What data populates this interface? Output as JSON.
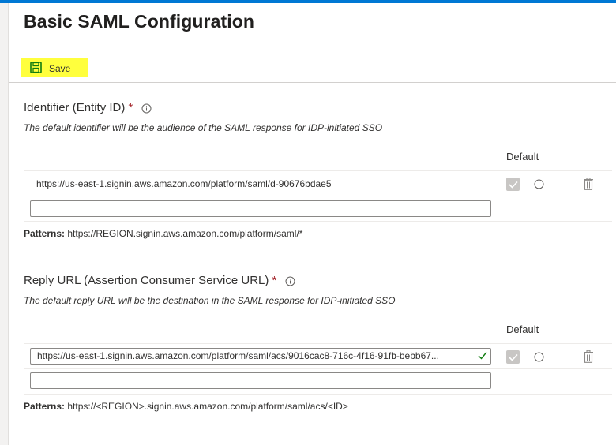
{
  "blade": {
    "title": "Basic SAML Configuration"
  },
  "toolbar": {
    "save_label": "Save",
    "highlight_color": "#ffff3d"
  },
  "identifier": {
    "label": "Identifier (Entity ID)",
    "required_mark": "*",
    "description": "The default identifier will be the audience of the SAML response for IDP-initiated SSO",
    "column_default": "Default",
    "rows": [
      {
        "value": "https://us-east-1.signin.aws.amazon.com/platform/saml/d-90676bdae5",
        "is_default": true
      }
    ],
    "new_value": "",
    "patterns_label": "Patterns:",
    "patterns_value": "https://REGION.signin.aws.amazon.com/platform/saml/*"
  },
  "reply_url": {
    "label": "Reply URL (Assertion Consumer Service URL)",
    "required_mark": "*",
    "description": "The default reply URL will be the destination in the SAML response for IDP-initiated SSO",
    "column_default": "Default",
    "rows": [
      {
        "value": "https://us-east-1.signin.aws.amazon.com/platform/saml/acs/9016cac8-716c-4f16-91fb-bebb67...",
        "is_default": true,
        "valid": true
      }
    ],
    "new_value": "",
    "patterns_label": "Patterns:",
    "patterns_value": "https://<REGION>.signin.aws.amazon.com/platform/saml/acs/<ID>"
  },
  "colors": {
    "accent": "#0078d4",
    "required": "#a4262c",
    "valid_check": "#107c10",
    "save_icon": "#107c10"
  }
}
